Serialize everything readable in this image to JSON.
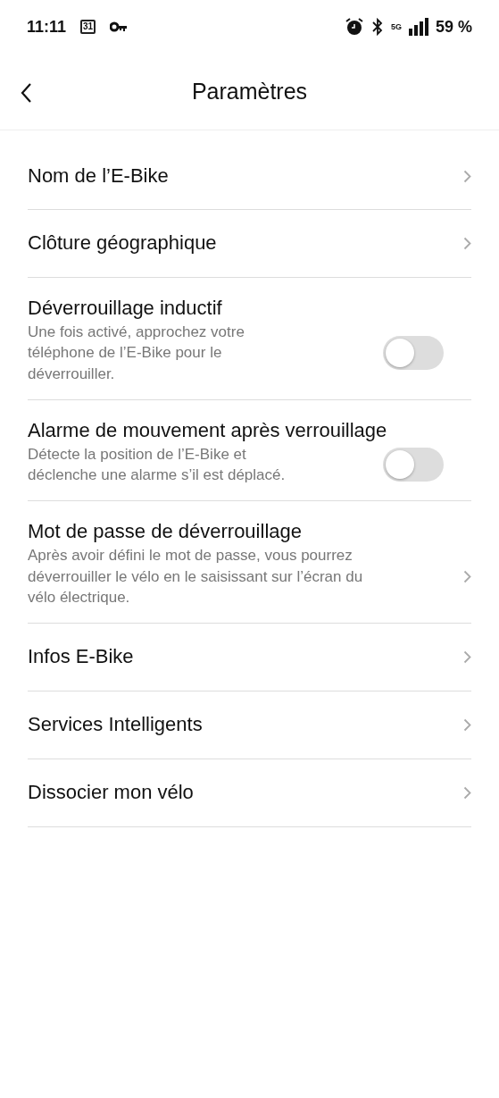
{
  "status_bar": {
    "time": "11:11",
    "calendar_day": "31",
    "network": "5G",
    "battery": "59 %"
  },
  "header": {
    "title": "Paramètres"
  },
  "items": [
    {
      "kind": "link",
      "title": "Nom de l’E-Bike"
    },
    {
      "kind": "link",
      "title": "Clôture géographique"
    },
    {
      "kind": "toggle",
      "title": "Déverrouillage inductif",
      "description": "Une fois activé, approchez votre téléphone de l’E-Bike pour le déverrouiller.",
      "on": false
    },
    {
      "kind": "toggle",
      "title": "Alarme de mouvement après verrouillage",
      "description": "Détecte la position de l’E-Bike et déclenche une alarme s’il est déplacé.",
      "on": false
    },
    {
      "kind": "link",
      "title": "Mot de passe de déverrouillage",
      "description": "Après avoir défini le mot de passe, vous pourrez déverrouiller le vélo en le saisissant sur l’écran du vélo électrique."
    },
    {
      "kind": "link",
      "title": "Infos E-Bike"
    },
    {
      "kind": "link",
      "title": "Services Intelligents"
    },
    {
      "kind": "link",
      "title": "Dissocier mon vélo"
    }
  ]
}
